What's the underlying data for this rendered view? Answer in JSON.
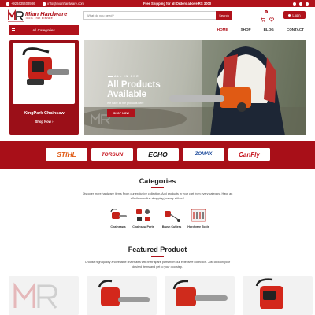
{
  "topbar": {
    "phone": "+923435403986",
    "email": "info@mianhardware.com",
    "shipping": "Free Shipping for all Orders above RS 3000"
  },
  "header": {
    "logo_name": "Mian Hardware",
    "logo_tagline": "Tools That Elevate",
    "search_placeholder": "What do you need?",
    "search_button": "Search",
    "cart_count": "0",
    "login_label": "Login"
  },
  "nav": {
    "all_categories": "All Categories",
    "menu": [
      "HOME",
      "SHOP",
      "BLOG",
      "CONTACT"
    ],
    "active": "HOME"
  },
  "side_card": {
    "product_name": "KingPark Chainsaw",
    "shop_now": "Shop Now"
  },
  "hero": {
    "kicker": "ALL IN ONE",
    "headline": "All Products Available",
    "subtext": "We have all the products here",
    "cta": "SHOP NOW"
  },
  "brands": [
    "STIHL",
    "TORSUN",
    "ECHO",
    "ZOMAX",
    "CanFly"
  ],
  "categories_section": {
    "title": "Categories",
    "description": "Discover more hardware items From our exclusive collection. Add products in your cart from every category. Have an effortless online shopping journey with us!",
    "items": [
      "Chainsaws",
      "Chainsaw Parts",
      "Brush Cutters",
      "Hardware Tools"
    ]
  },
  "featured_section": {
    "title": "Featured Product",
    "description": "Choose high-quality and reliable chainsaws with their spare parts from our extensive collection. Just click on your desired items and get to your doorstep."
  },
  "colors": {
    "brand_red": "#b0121b",
    "brand_dark_red": "#9b0f18"
  }
}
